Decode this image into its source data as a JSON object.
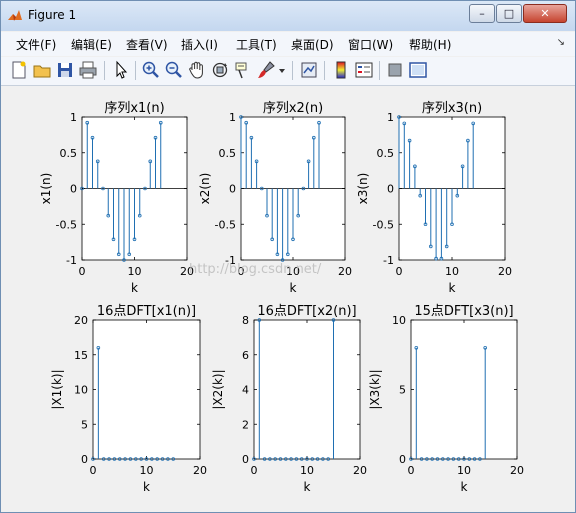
{
  "window": {
    "title": "Figure 1",
    "minimize": "–",
    "maximize": "□",
    "close": "✕"
  },
  "menu": {
    "items": [
      "文件(F)",
      "编辑(E)",
      "查看(V)",
      "插入(I)",
      "工具(T)",
      "桌面(D)",
      "窗口(W)",
      "帮助(H)"
    ],
    "overflow": "↘"
  },
  "toolbar": {
    "icons": [
      "new-figure-icon",
      "open-icon",
      "save-icon",
      "print-icon",
      "pointer-icon",
      "zoom-in-icon",
      "zoom-out-icon",
      "pan-icon",
      "rotate-3d-icon",
      "data-cursor-icon",
      "brush-icon",
      "dropdown-arrow-icon",
      "link-plot-icon",
      "colorbar-icon",
      "legend-icon",
      "hide-plot-tools-icon",
      "show-plot-tools-icon"
    ]
  },
  "colors": {
    "stem": "#1f6fb2",
    "axis": "#000000",
    "title_bar": "#c4d7ef"
  },
  "watermark": "http://blog.csdn.net/",
  "chart_data": [
    {
      "type": "stem",
      "title": "序列x1(n)",
      "xlabel": "k",
      "ylabel": "x1(n)",
      "xlim": [
        0,
        20
      ],
      "ylim": [
        -1,
        1
      ],
      "xticks": [
        0,
        10,
        20
      ],
      "yticks": [
        -1,
        -0.5,
        0,
        0.5,
        1
      ],
      "x": [
        0,
        1,
        2,
        3,
        4,
        5,
        6,
        7,
        8,
        9,
        10,
        11,
        12,
        13,
        14,
        15
      ],
      "values": [
        0,
        0.92,
        0.71,
        0.38,
        0,
        -0.38,
        -0.71,
        -0.92,
        -1,
        -0.92,
        -0.71,
        -0.38,
        0,
        0.38,
        0.71,
        0.92
      ]
    },
    {
      "type": "stem",
      "title": "序列x2(n)",
      "xlabel": "k",
      "ylabel": "x2(n)",
      "xlim": [
        0,
        20
      ],
      "ylim": [
        -1,
        1
      ],
      "xticks": [
        0,
        10,
        20
      ],
      "yticks": [
        -1,
        -0.5,
        0,
        0.5,
        1
      ],
      "x": [
        0,
        1,
        2,
        3,
        4,
        5,
        6,
        7,
        8,
        9,
        10,
        11,
        12,
        13,
        14,
        15
      ],
      "values": [
        1,
        0.92,
        0.71,
        0.38,
        0,
        -0.38,
        -0.71,
        -0.92,
        -1,
        -0.92,
        -0.71,
        -0.38,
        0,
        0.38,
        0.71,
        0.92
      ]
    },
    {
      "type": "stem",
      "title": "序列x3(n)",
      "xlabel": "k",
      "ylabel": "x3(n)",
      "xlim": [
        0,
        20
      ],
      "ylim": [
        -1,
        1
      ],
      "xticks": [
        0,
        10,
        20
      ],
      "yticks": [
        -1,
        -0.5,
        0,
        0.5,
        1
      ],
      "x": [
        0,
        1,
        2,
        3,
        4,
        5,
        6,
        7,
        8,
        9,
        10,
        11,
        12,
        13,
        14
      ],
      "values": [
        1,
        0.91,
        0.67,
        0.31,
        -0.1,
        -0.5,
        -0.81,
        -0.98,
        -0.98,
        -0.81,
        -0.5,
        -0.1,
        0.31,
        0.67,
        0.91
      ]
    },
    {
      "type": "stem",
      "title": "16点DFT[x1(n)]",
      "xlabel": "k",
      "ylabel": "|X1(k)|",
      "xlim": [
        0,
        20
      ],
      "ylim": [
        0,
        20
      ],
      "xticks": [
        0,
        10,
        20
      ],
      "yticks": [
        0,
        5,
        10,
        15,
        20
      ],
      "x": [
        0,
        1,
        2,
        3,
        4,
        5,
        6,
        7,
        8,
        9,
        10,
        11,
        12,
        13,
        14,
        15
      ],
      "values": [
        0,
        16,
        0,
        0,
        0,
        0,
        0,
        0,
        0,
        0,
        0,
        0,
        0,
        0,
        0,
        0
      ]
    },
    {
      "type": "stem",
      "title": "16点DFT[x2(n)]",
      "xlabel": "k",
      "ylabel": "|X2(k)|",
      "xlim": [
        0,
        20
      ],
      "ylim": [
        0,
        8
      ],
      "xticks": [
        0,
        10,
        20
      ],
      "yticks": [
        0,
        2,
        4,
        6,
        8
      ],
      "x": [
        0,
        1,
        2,
        3,
        4,
        5,
        6,
        7,
        8,
        9,
        10,
        11,
        12,
        13,
        14,
        15
      ],
      "values": [
        0,
        8,
        0,
        0,
        0,
        0,
        0,
        0,
        0,
        0,
        0,
        0,
        0,
        0,
        0,
        8
      ]
    },
    {
      "type": "stem",
      "title": "15点DFT[x3(n)]",
      "xlabel": "k",
      "ylabel": "|X3(k)|",
      "xlim": [
        0,
        20
      ],
      "ylim": [
        0,
        10
      ],
      "xticks": [
        0,
        10,
        20
      ],
      "yticks": [
        0,
        5,
        10
      ],
      "x": [
        0,
        1,
        2,
        3,
        4,
        5,
        6,
        7,
        8,
        9,
        10,
        11,
        12,
        13,
        14
      ],
      "values": [
        0,
        8,
        0,
        0,
        0,
        0,
        0,
        0,
        0,
        0,
        0,
        0,
        0,
        0,
        8
      ]
    }
  ]
}
